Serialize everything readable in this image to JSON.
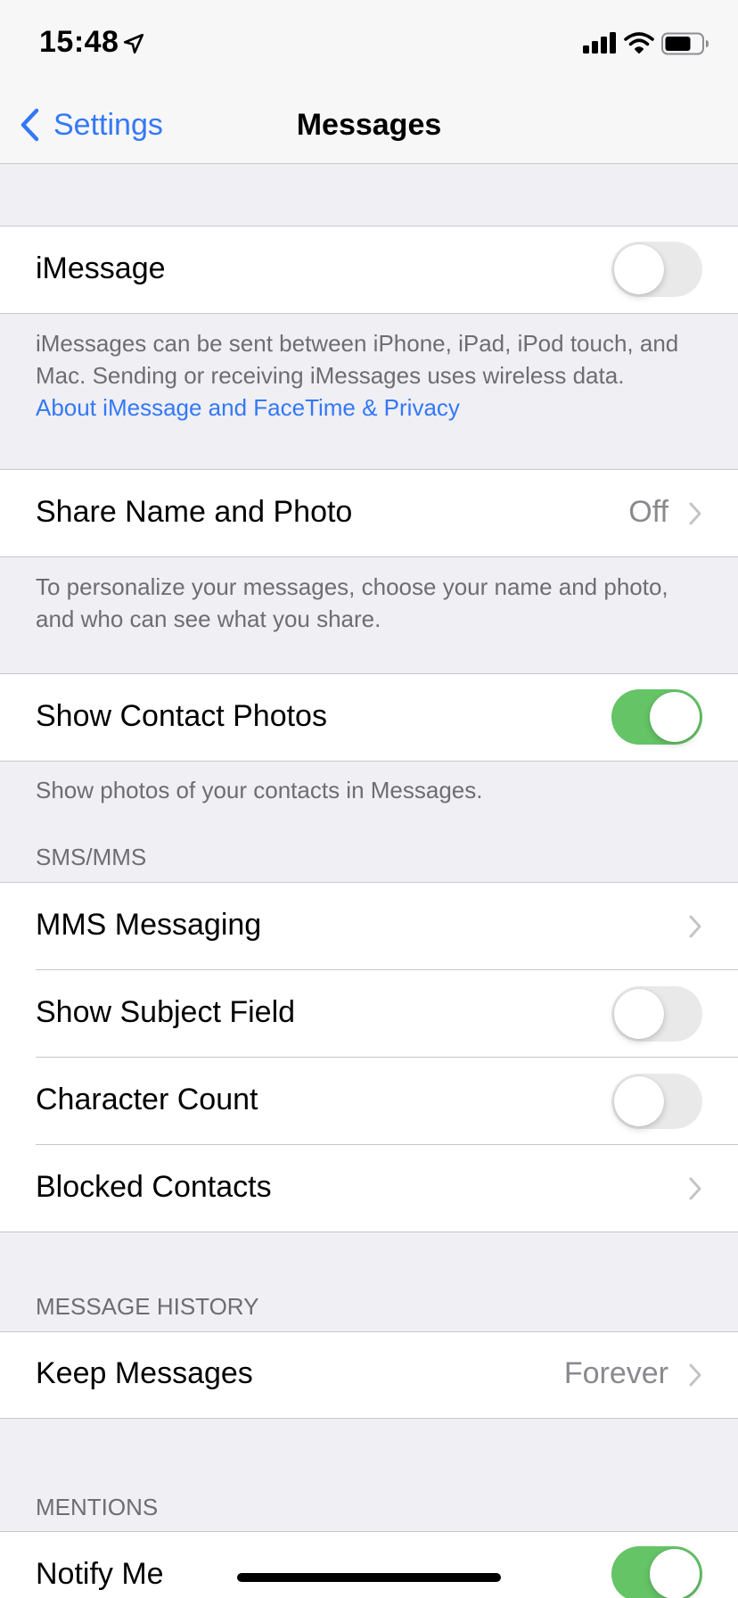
{
  "status_bar": {
    "time": "15:48"
  },
  "nav": {
    "back_label": "Settings",
    "title": "Messages"
  },
  "imessage": {
    "label": "iMessage",
    "enabled": false,
    "footer_text": "iMessages can be sent between iPhone, iPad, iPod touch, and Mac. Sending or receiving iMessages uses wireless data.",
    "footer_link": "About iMessage and FaceTime & Privacy"
  },
  "share_name": {
    "label": "Share Name and Photo",
    "value": "Off",
    "footer_text": "To personalize your messages, choose your name and photo, and who can see what you share."
  },
  "contact_photos": {
    "label": "Show Contact Photos",
    "enabled": true,
    "footer_text": "Show photos of your contacts in Messages."
  },
  "sms_mms": {
    "header": "SMS/MMS",
    "items": [
      {
        "label": "MMS Messaging",
        "type": "disclosure"
      },
      {
        "label": "Show Subject Field",
        "type": "toggle",
        "enabled": false
      },
      {
        "label": "Character Count",
        "type": "toggle",
        "enabled": false
      },
      {
        "label": "Blocked Contacts",
        "type": "disclosure"
      }
    ]
  },
  "message_history": {
    "header": "MESSAGE HISTORY",
    "keep_label": "Keep Messages",
    "keep_value": "Forever"
  },
  "mentions": {
    "header": "MENTIONS",
    "notify_label": "Notify Me",
    "notify_enabled": true
  },
  "colors": {
    "accent": "#3478f6",
    "toggle_on": "#65c466",
    "toggle_off": "#e9e9ea",
    "background": "#efeff4"
  }
}
